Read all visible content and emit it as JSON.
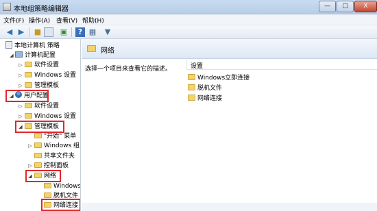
{
  "window": {
    "title": "本地组策略编辑器",
    "min": "—",
    "max": "□",
    "close": "X"
  },
  "menu": [
    "文件(F)",
    "操作(A)",
    "查看(V)",
    "帮助(H)"
  ],
  "tree": [
    {
      "label": "本地计算机 策略",
      "icon": "policy-icon"
    },
    {
      "label": "计算机配置",
      "icon": "computer-icon"
    },
    {
      "label": "软件设置",
      "icon": "folder-icon"
    },
    {
      "label": "Windows 设置",
      "icon": "folder-icon"
    },
    {
      "label": "管理模板",
      "icon": "folder-icon"
    },
    {
      "label": "用户配置",
      "icon": "user-icon"
    },
    {
      "label": "软件设置",
      "icon": "folder-icon"
    },
    {
      "label": "Windows 设置",
      "icon": "folder-icon"
    },
    {
      "label": "管理模板",
      "icon": "folder-icon"
    },
    {
      "label": "\"开始\" 菜单",
      "icon": "folder-icon"
    },
    {
      "label": "Windows 组",
      "icon": "folder-icon"
    },
    {
      "label": "共享文件夹",
      "icon": "folder-icon"
    },
    {
      "label": "控制面板",
      "icon": "folder-icon"
    },
    {
      "label": "网络",
      "icon": "folder-icon"
    },
    {
      "label": "Windows",
      "icon": "folder-icon"
    },
    {
      "label": "脱机文件",
      "icon": "folder-icon"
    },
    {
      "label": "网络连接",
      "icon": "folder-icon"
    }
  ],
  "panel": {
    "title": "网络",
    "description": "选择一个项目来查看它的描述。",
    "column_header": "设置",
    "settings": [
      "Windows立即连接",
      "脱机文件",
      "网络连接"
    ]
  },
  "colors": {
    "highlight": "#e0262a",
    "folder": "#f3d36b"
  }
}
